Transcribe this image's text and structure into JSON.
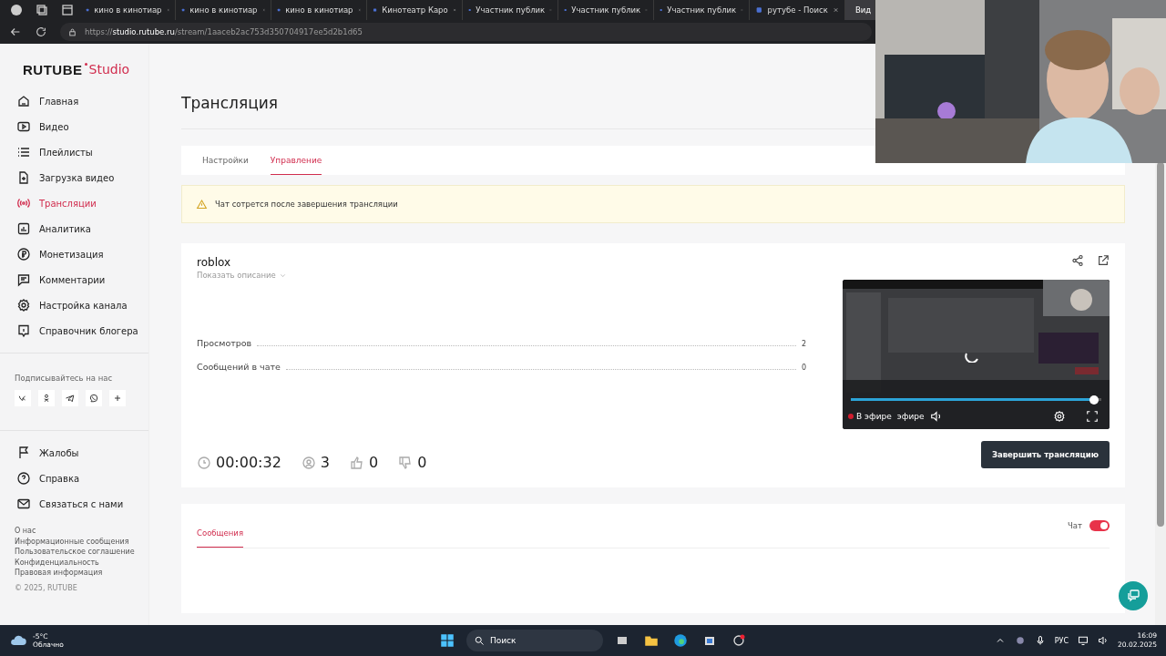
{
  "browser": {
    "tabs": [
      {
        "title": "кино в кинотиар",
        "selected": false
      },
      {
        "title": "кино в кинотиар",
        "selected": false
      },
      {
        "title": "кино в кинотиар",
        "selected": false
      },
      {
        "title": "Кинотеатр Каро",
        "selected": false
      },
      {
        "title": "Участник публик",
        "selected": false
      },
      {
        "title": "Участник публик",
        "selected": false
      },
      {
        "title": "Участник публик",
        "selected": false
      },
      {
        "title": "рутубе - Поиск",
        "selected": false
      },
      {
        "title": "Вид",
        "selected": true
      }
    ],
    "address": "https://**studio.rutube.ru**/stream/1aaceb2ac753d350704917ee5d2b1d65"
  },
  "logo": {
    "brand": "RUTUBE",
    "product": "Studio"
  },
  "nav": [
    {
      "label": "Главная",
      "selected": false
    },
    {
      "label": "Видео",
      "selected": false
    },
    {
      "label": "Плейлисты",
      "selected": false
    },
    {
      "label": "Загрузка видео",
      "selected": false
    },
    {
      "label": "Трансляции",
      "selected": true
    },
    {
      "label": "Аналитика",
      "selected": false
    },
    {
      "label": "Монетизация",
      "selected": false
    },
    {
      "label": "Комментарии",
      "selected": false
    },
    {
      "label": "Настройка канала",
      "selected": false
    },
    {
      "label": "Справочник блогера",
      "selected": false
    }
  ],
  "follow_label": "Подписывайтесь на нас",
  "support_links": [
    "Жалобы",
    "Справка",
    "Связаться с нами"
  ],
  "footer_links": [
    "О нас",
    "Информационные сообщения",
    "Пользовательское соглашение",
    "Конфиденциальность",
    "Правовая информация"
  ],
  "copyright": "© 2025, RUTUBE",
  "page_title": "Трансляция",
  "tabs": [
    {
      "label": "Настройки",
      "selected": false
    },
    {
      "label": "Управление",
      "selected": true
    }
  ],
  "notice": "Чат сотрется после завершения трансляции",
  "stream": {
    "title": "roblox",
    "show_description": "Показать описание",
    "stats": [
      {
        "label": "Просмотров",
        "value": "2"
      },
      {
        "label": "Сообщений в чате",
        "value": "0"
      }
    ],
    "duration": "00:00:32",
    "viewers": "3",
    "likes": "0",
    "dislikes": "0",
    "player": {
      "live_label": "В эфире",
      "live_echo": "эфире",
      "level": 0.97
    },
    "end_button": "Завершить трансляцию"
  },
  "chat": {
    "tab": {
      "label": "Сообщения",
      "selected": true
    },
    "toggle_label": "Чат",
    "on": true
  },
  "taskbar": {
    "temp": "-5°C",
    "weather": "Облачно",
    "search": "Поиск",
    "lang": "РУС",
    "time": "16:09",
    "date": "20.02.2025"
  }
}
